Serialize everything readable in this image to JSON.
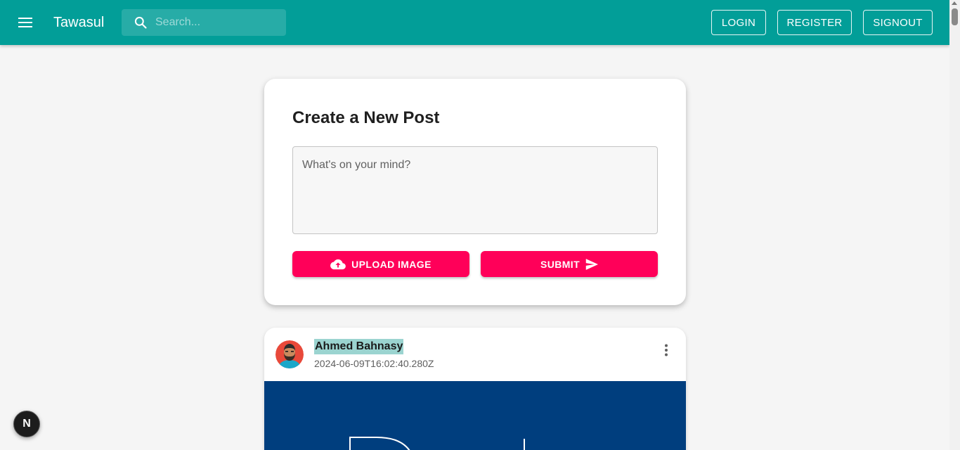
{
  "appbar": {
    "brand": "Tawasul",
    "menu_icon": "hamburger-menu-icon",
    "search": {
      "placeholder": "Search...",
      "value": "",
      "icon": "search-icon"
    },
    "buttons": {
      "login": "LOGIN",
      "register": "REGISTER",
      "signout": "SIGNOUT"
    },
    "color": "#029e98"
  },
  "create_post": {
    "title": "Create a New Post",
    "textarea_placeholder": "What's on your mind?",
    "upload_button": {
      "label": "UPLOAD IMAGE",
      "icon": "cloud-upload-icon"
    },
    "submit_button": {
      "label": "SUBMIT",
      "icon": "send-icon"
    },
    "accent_color": "#ff0059"
  },
  "post": {
    "author": "Ahmed Bahnasy",
    "timestamp": "2024-06-09T16:02:40.280Z",
    "more_icon": "more-vertical-icon",
    "image_color": "#003e7e"
  },
  "badge": {
    "label": "N"
  }
}
